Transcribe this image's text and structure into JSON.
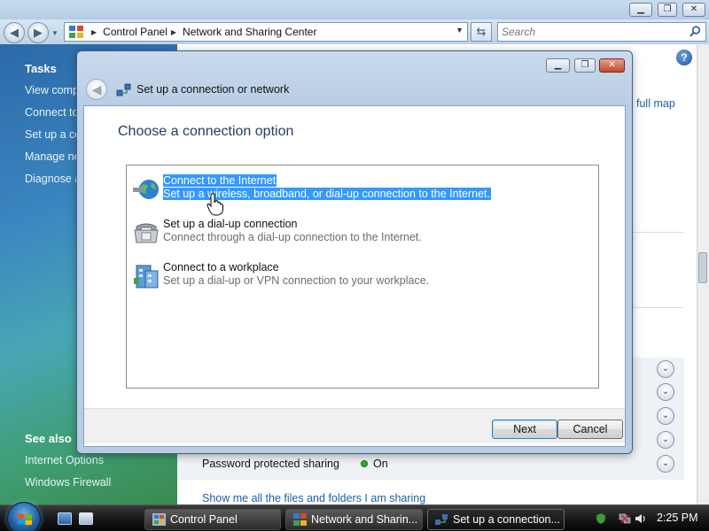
{
  "control_panel": {
    "breadcrumb": [
      "Control Panel",
      "Network and Sharing Center"
    ],
    "search_placeholder": "Search",
    "sidebar": {
      "tasks_heading": "Tasks",
      "tasks": [
        "View comp",
        "Connect to",
        "Set up a co",
        "Manage ne",
        "Diagnose a"
      ],
      "see_also_heading": "See also",
      "see_also": [
        "Internet Options",
        "Windows Firewall"
      ]
    },
    "view_full_map": "full map",
    "password_sharing_label": "Password protected sharing",
    "password_sharing_value": "On",
    "show_sharing_link": "Show me all the files and folders I am sharing"
  },
  "dialog": {
    "title": "Set up a connection or network",
    "heading": "Choose a connection option",
    "options": [
      {
        "title": "Connect to the Internet",
        "desc": "Set up a wireless, broadband, or dial-up connection to the Internet.",
        "icon": "globe-icon",
        "selected": true
      },
      {
        "title": "Set up a dial-up connection",
        "desc": "Connect through a dial-up connection to the Internet.",
        "icon": "phone-icon",
        "selected": false
      },
      {
        "title": "Connect to a workplace",
        "desc": "Set up a dial-up or VPN connection to your workplace.",
        "icon": "workplace-icon",
        "selected": false
      }
    ],
    "next_label": "Next",
    "cancel_label": "Cancel"
  },
  "taskbar": {
    "buttons": [
      "Control Panel",
      "Network and Sharin...",
      "Set up a connection..."
    ],
    "clock": "2:25 PM"
  },
  "colors": {
    "selection": "#3399ff",
    "link": "#1c5fa8",
    "heading": "#1f3d66"
  }
}
